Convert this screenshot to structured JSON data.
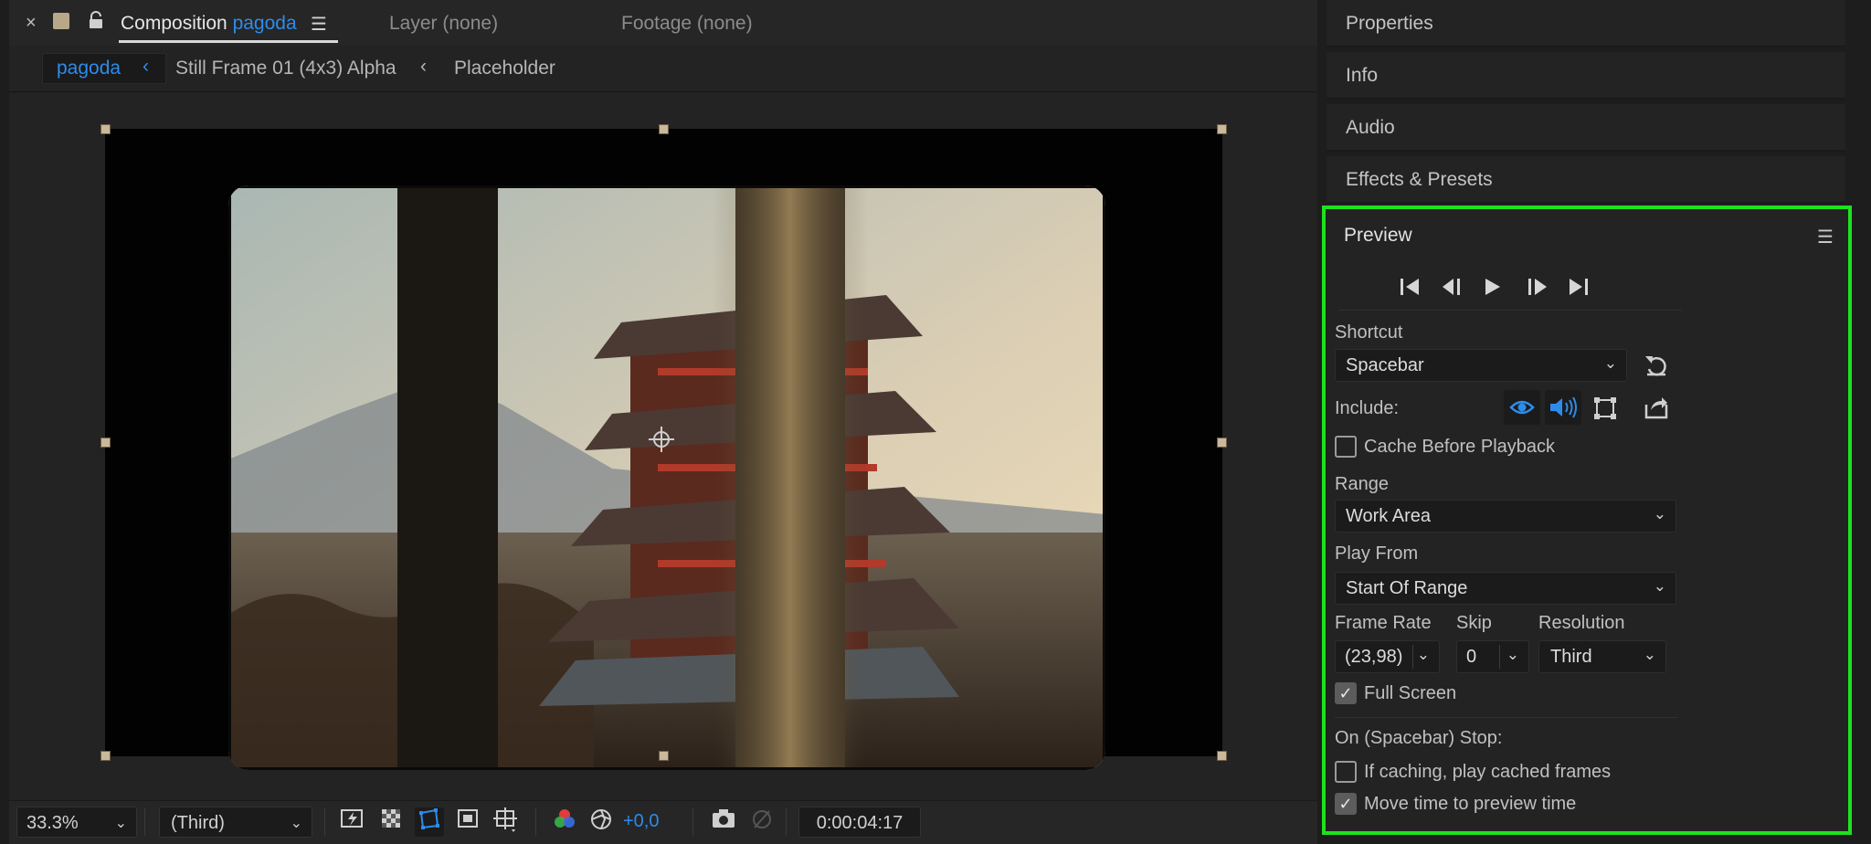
{
  "composition_tabs": {
    "close": "×",
    "comp_title": "Composition",
    "comp_name": "pagoda",
    "layer_tab": "Layer (none)",
    "footage_tab": "Footage (none)"
  },
  "breadcrumbs": [
    {
      "label": "pagoda"
    },
    {
      "label": "Still Frame 01 (4x3) Alpha"
    },
    {
      "label": "Placeholder"
    }
  ],
  "viewer_toolbar": {
    "zoom": "33.3%",
    "resolution": "(Third)",
    "exposure": "+0,0",
    "timecode": "0:00:04:17"
  },
  "side_panels": [
    {
      "label": "Properties"
    },
    {
      "label": "Info"
    },
    {
      "label": "Audio"
    },
    {
      "label": "Effects & Presets"
    }
  ],
  "preview": {
    "title": "Preview",
    "shortcut_label": "Shortcut",
    "shortcut_value": "Spacebar",
    "include_label": "Include:",
    "cache_before_playback": {
      "label": "Cache Before Playback",
      "checked": false
    },
    "range_label": "Range",
    "range_value": "Work Area",
    "play_from_label": "Play From",
    "play_from_value": "Start Of Range",
    "frame_rate_label": "Frame Rate",
    "frame_rate_value": "(23,98)",
    "skip_label": "Skip",
    "skip_value": "0",
    "resolution_label": "Resolution",
    "resolution_value": "Third",
    "full_screen": {
      "label": "Full Screen",
      "checked": true
    },
    "stop_label": "On (Spacebar) Stop:",
    "if_caching": {
      "label": "If caching, play cached frames",
      "checked": false
    },
    "move_time": {
      "label": "Move time to preview time",
      "checked": true
    }
  },
  "colors": {
    "accent_blue": "#2d8ceb",
    "highlight_green": "#1ee21e",
    "panel_bg": "#232323"
  }
}
